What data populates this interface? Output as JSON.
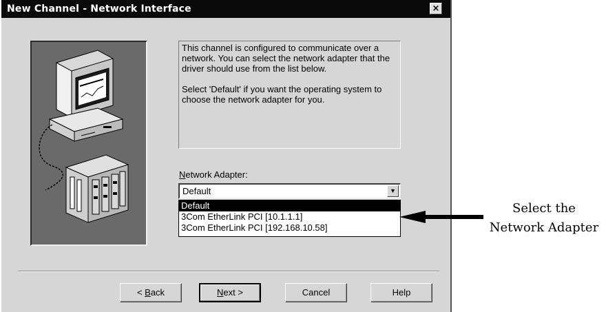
{
  "window": {
    "title": "New Channel - Network Interface",
    "close_label": "×"
  },
  "description": {
    "paragraph1": "This channel is configured to communicate over a network.  You can select the network adapter that the driver should use from the list below.",
    "paragraph2": "Select 'Default' if you want the operating system to choose the network adapter for you."
  },
  "network_adapter": {
    "label_accel": "N",
    "label_rest": "etwork Adapter:",
    "selected_value": "Default",
    "options": [
      "Default",
      "3Com EtherLink PCI [10.1.1.1]",
      "3Com EtherLink PCI [192.168.10.58]"
    ],
    "highlighted_option": "Default"
  },
  "buttons": {
    "back_prefix": "< ",
    "back_accel": "B",
    "back_rest": "ack",
    "next_accel": "N",
    "next_rest": "ext >",
    "cancel": "Cancel",
    "help": "Help"
  },
  "annotation": {
    "line1": "Select the",
    "line2": "Network Adapter"
  }
}
